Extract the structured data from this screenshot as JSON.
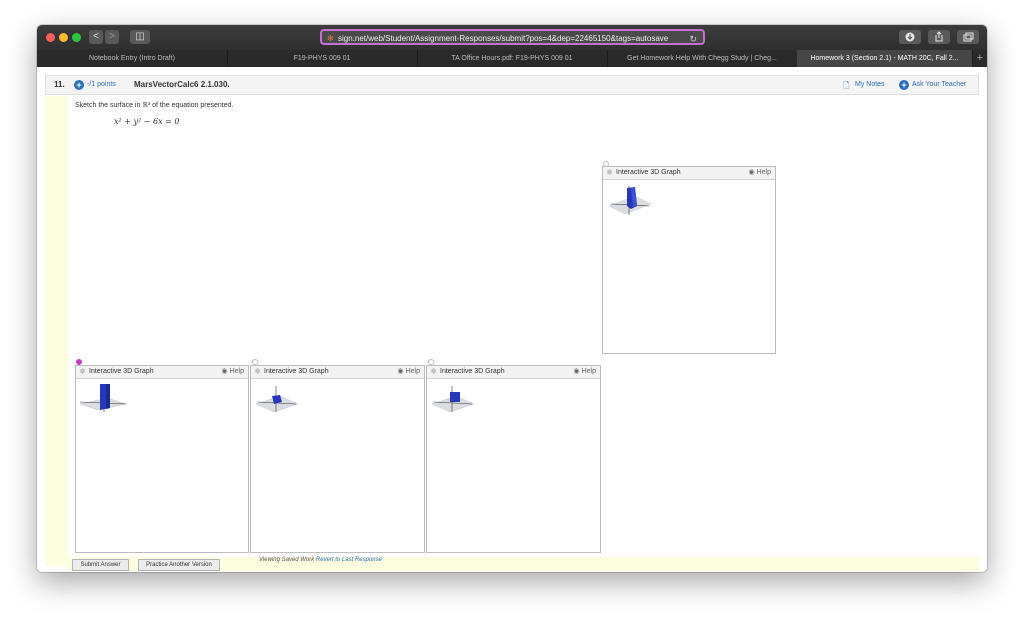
{
  "browser": {
    "url": "sign.net/web/Student/Assignment-Responses/submit?pos=4&dep=22465150&tags=autosave",
    "back_label": "<",
    "forward_label": ">",
    "sidebar_label": "◫",
    "tabs": [
      {
        "label": "Notebook Entry (Intro Draft)"
      },
      {
        "label": "F19-PHYS 009 01"
      },
      {
        "label": "TA Office Hours.pdf: F19-PHYS 009 01"
      },
      {
        "label": "Get Homework Help With Chegg Study | Cheg..."
      },
      {
        "label": "Homework 3 (Section 2.1) - MATH 20C, Fall 2..."
      }
    ],
    "new_tab_label": "+"
  },
  "question": {
    "number": "11.",
    "points": "-/1 points",
    "id": "MarsVectorCalc6 2.1.030.",
    "my_notes": "My Notes",
    "ask_teacher": "Ask Your Teacher",
    "prompt": "Sketch the surface in ℝ³ of the equation presented.",
    "equation": "x² + y² − 6x = 0"
  },
  "graphs": [
    {
      "title": "Interactive 3D Graph",
      "help": "Help"
    },
    {
      "title": "Interactive 3D Graph",
      "help": "Help"
    },
    {
      "title": "Interactive 3D Graph",
      "help": "Help"
    },
    {
      "title": "Interactive 3D Graph",
      "help": "Help"
    }
  ],
  "footer": {
    "submit": "Submit Answer",
    "practice": "Practice Another Version",
    "viewing": "Viewing Saved Work",
    "revert": "Revert to Last Response"
  },
  "colors": {
    "accent": "#2a6fb8",
    "surface_blue": "#2438b8",
    "highlight": "#fdfde0",
    "url_border": "#c76fd0"
  }
}
